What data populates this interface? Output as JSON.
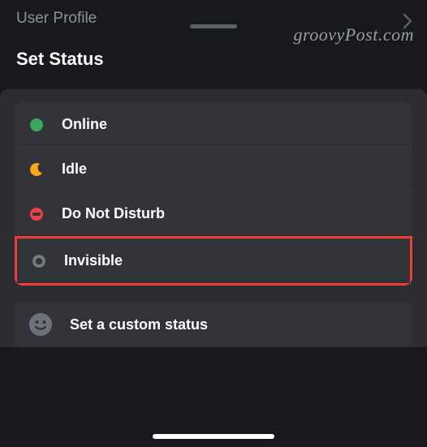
{
  "header": {
    "back_label": "User Profile"
  },
  "title": "Set Status",
  "statuses": [
    {
      "id": "online",
      "label": "Online"
    },
    {
      "id": "idle",
      "label": "Idle"
    },
    {
      "id": "dnd",
      "label": "Do Not Disturb"
    },
    {
      "id": "invisible",
      "label": "Invisible",
      "highlighted": true
    }
  ],
  "custom_status": {
    "label": "Set a custom status"
  },
  "watermark": "groovyPost.com",
  "colors": {
    "online": "#3ba55d",
    "idle": "#faa81a",
    "dnd": "#ed4245",
    "invisible": "#747880",
    "highlight": "#f63a3a"
  }
}
